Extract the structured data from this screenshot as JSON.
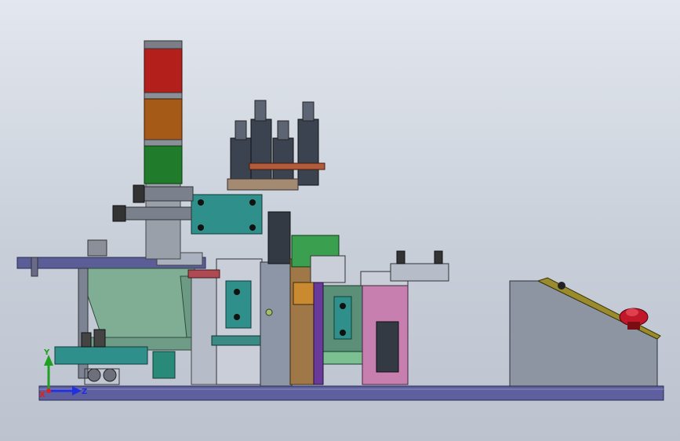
{
  "app": {
    "kind": "3D CAD viewport"
  },
  "colors": {
    "background_top": "#e3e7ee",
    "background_bottom": "#bcc3cf",
    "base_plate": "#5d5f9e",
    "tower_red": "#b3201c",
    "tower_amber": "#a55a17",
    "tower_green": "#207b2a",
    "teal_block": "#2f8f8a",
    "hopper_green": "#7fae95",
    "pink_block": "#c77fb0",
    "steel_grey": "#8d96a6",
    "olive_panel": "#9a8b2c",
    "estop_red": "#c0182a"
  },
  "triad": {
    "x_label": "X",
    "y_label": "Y",
    "z_label": "Z",
    "x_color": "#e02020",
    "y_color": "#20a020",
    "z_color": "#2030e0"
  }
}
